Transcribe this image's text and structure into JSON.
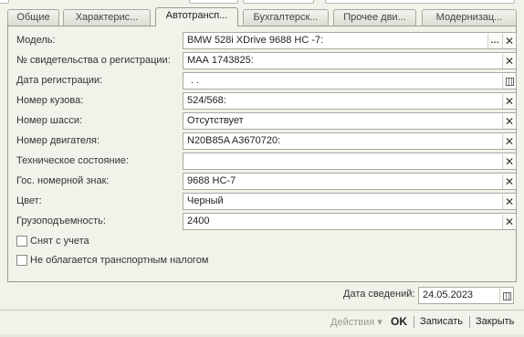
{
  "tabs": [
    {
      "label": "Общие",
      "active": false
    },
    {
      "label": "Характерис...",
      "active": false
    },
    {
      "label": "Автотрансп...",
      "active": true
    },
    {
      "label": "Бухгалтерск...",
      "active": false
    },
    {
      "label": "Прочее дви...",
      "active": false
    },
    {
      "label": "Модернизац...",
      "active": false
    }
  ],
  "fields": {
    "model": {
      "label": "Модель:",
      "value": "BMW 528i XDrive 9688 НС -7:"
    },
    "reg_certificate": {
      "label": "№ свидетельства о регистрации:",
      "value": "МАА 1743825:"
    },
    "reg_date": {
      "label": "Дата регистрации:",
      "value": " .  ."
    },
    "body_number": {
      "label": "Номер кузова:",
      "value": "524/568:"
    },
    "chassis_number": {
      "label": "Номер шасси:",
      "value": "Отсутствует"
    },
    "engine_number": {
      "label": "Номер двигателя:",
      "value": "N20B85A A3670720:"
    },
    "tech_condition": {
      "label": "Техническое состояние:",
      "value": ""
    },
    "plate_number": {
      "label": "Гос. номерной знак:",
      "value": "9688 НС-7"
    },
    "color": {
      "label": "Цвет:",
      "value": "Черный"
    },
    "capacity": {
      "label": "Грузоподъемность:",
      "value": "2400"
    }
  },
  "checkboxes": {
    "deregistered": {
      "label": "Снят с учета",
      "checked": false
    },
    "tax_exempt": {
      "label": "Не облагается транспортным налогом",
      "checked": false
    }
  },
  "info_date": {
    "label": "Дата сведений:",
    "value": "24.05.2023"
  },
  "statusbar": {
    "actions_label": "Действия ▾",
    "ok_label": "OK",
    "write_label": "Записать",
    "close_label": "Закрыть"
  },
  "icons": {
    "clear": "close-icon",
    "select": "ellipsis-icon",
    "calendar": "calendar-icon"
  },
  "colors": {
    "background": "#f2f1ea",
    "field_border": "#a9a9a2",
    "disabled_text": "#9a9a92"
  }
}
